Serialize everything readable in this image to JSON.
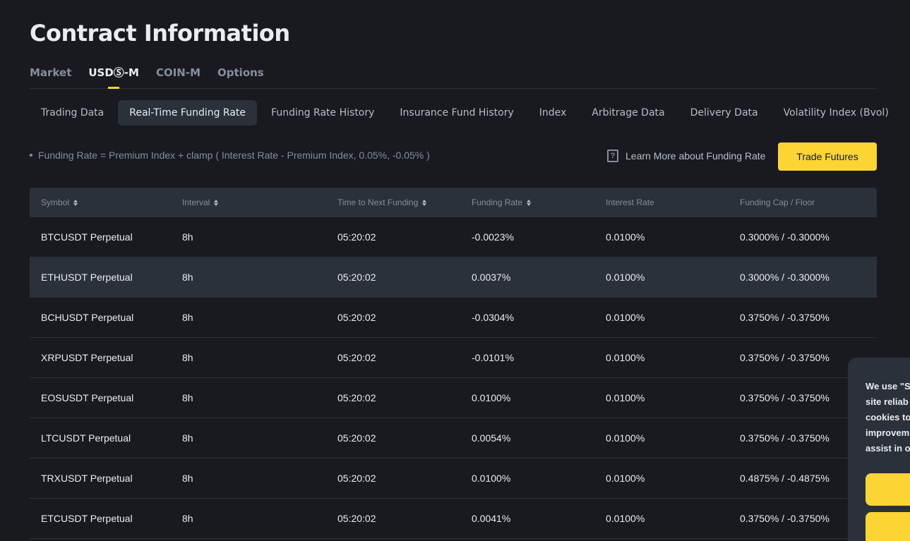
{
  "page_title": "Contract Information",
  "market_tabs": [
    {
      "label": "Market",
      "active": false
    },
    {
      "label": "USDⓈ-M",
      "active": true
    },
    {
      "label": "COIN-M",
      "active": false
    },
    {
      "label": "Options",
      "active": false
    }
  ],
  "sub_tabs": [
    {
      "label": "Trading Data",
      "active": false
    },
    {
      "label": "Real-Time Funding Rate",
      "active": true
    },
    {
      "label": "Funding Rate History",
      "active": false
    },
    {
      "label": "Insurance Fund History",
      "active": false
    },
    {
      "label": "Index",
      "active": false
    },
    {
      "label": "Arbitrage Data",
      "active": false
    },
    {
      "label": "Delivery Data",
      "active": false
    },
    {
      "label": "Volatility Index (Bvol)",
      "active": false
    }
  ],
  "formula_text": "Funding Rate = Premium Index + clamp ( Interest Rate - Premium Index, 0.05%, -0.05% )",
  "learn_more_label": "Learn More about Funding Rate",
  "trade_button_label": "Trade Futures",
  "table": {
    "headers": [
      {
        "label": "Symbol",
        "sortable": true
      },
      {
        "label": "Interval",
        "sortable": true
      },
      {
        "label": "Time to Next Funding",
        "sortable": true
      },
      {
        "label": "Funding Rate",
        "sortable": true
      },
      {
        "label": "Interest Rate",
        "sortable": false
      },
      {
        "label": "Funding Cap / Floor",
        "sortable": false
      }
    ],
    "rows": [
      [
        "BTCUSDT Perpetual",
        "8h",
        "05:20:02",
        "-0.0023%",
        "0.0100%",
        "0.3000% / -0.3000%"
      ],
      [
        "ETHUSDT Perpetual",
        "8h",
        "05:20:02",
        "0.0037%",
        "0.0100%",
        "0.3000% / -0.3000%"
      ],
      [
        "BCHUSDT Perpetual",
        "8h",
        "05:20:02",
        "-0.0304%",
        "0.0100%",
        "0.3750% / -0.3750%"
      ],
      [
        "XRPUSDT Perpetual",
        "8h",
        "05:20:02",
        "-0.0101%",
        "0.0100%",
        "0.3750% / -0.3750%"
      ],
      [
        "EOSUSDT Perpetual",
        "8h",
        "05:20:02",
        "0.0100%",
        "0.0100%",
        "0.3750% / -0.3750%"
      ],
      [
        "LTCUSDT Perpetual",
        "8h",
        "05:20:02",
        "0.0054%",
        "0.0100%",
        "0.3750% / -0.3750%"
      ],
      [
        "TRXUSDT Perpetual",
        "8h",
        "05:20:02",
        "0.0100%",
        "0.0100%",
        "0.4875% / -0.4875%"
      ],
      [
        "ETCUSDT Perpetual",
        "8h",
        "05:20:02",
        "0.0041%",
        "0.0100%",
        "0.3750% / -0.3750%"
      ]
    ],
    "highlighted_row": 1
  },
  "cookie_notice": {
    "text_lines": [
      "We use \"S",
      "site reliab",
      "cookies to",
      "improvem",
      "assist in o"
    ]
  },
  "colors": {
    "background": "#181a20",
    "accent": "#fcd535",
    "panel": "#2b3139"
  }
}
